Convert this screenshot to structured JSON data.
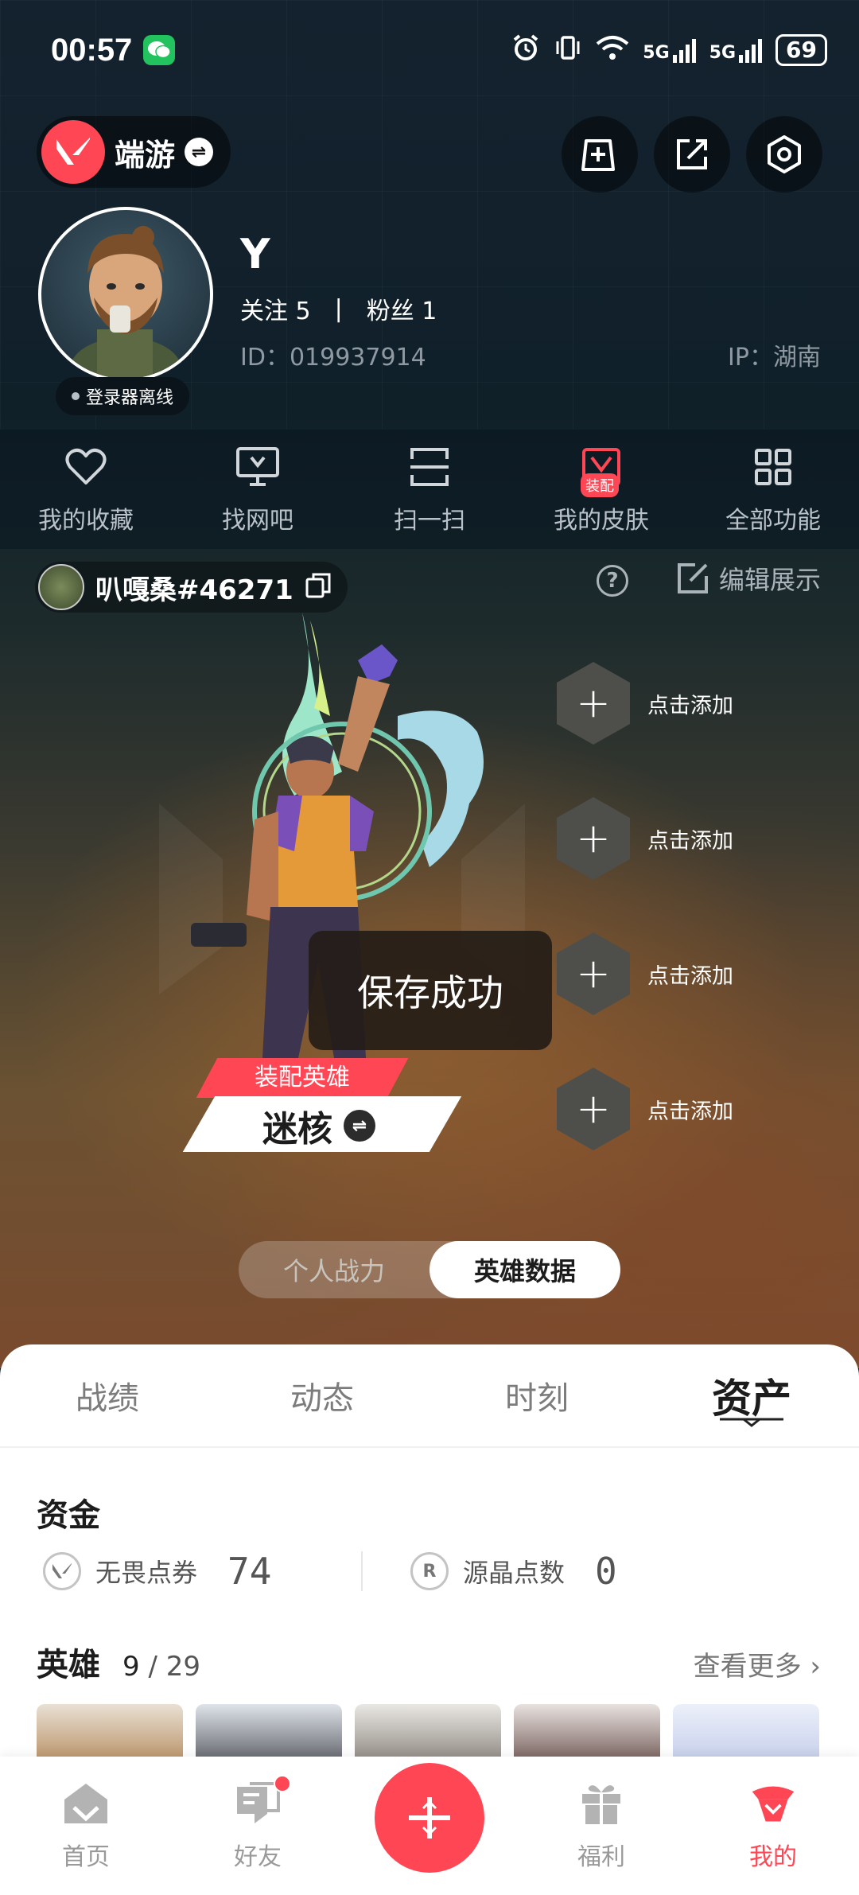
{
  "status_bar": {
    "time": "00:57",
    "signal_1": "5G",
    "signal_2": "5G",
    "battery": "69"
  },
  "header": {
    "brand_name": "端游"
  },
  "profile": {
    "name": "Y",
    "follow_label": "关注 5",
    "separator": "|",
    "fans_label": "粉丝 1",
    "id": "ID：019937914",
    "ip": "IP：湖南",
    "offline_badge": "登录器离线"
  },
  "quick_actions": [
    {
      "label": "我的收藏",
      "icon": "heart-icon"
    },
    {
      "label": "找网吧",
      "icon": "monitor-icon"
    },
    {
      "label": "扫一扫",
      "icon": "scan-icon"
    },
    {
      "label": "我的皮肤",
      "icon": "skin-icon",
      "tag": "装配"
    },
    {
      "label": "全部功能",
      "icon": "grid-icon"
    }
  ],
  "game_account": {
    "riot_id": "叭嘎桑#46271",
    "help": "?",
    "edit_display": "编辑展示"
  },
  "showcase": {
    "slot_label": "点击添加",
    "toast": "保存成功",
    "equip_label": "装配英雄",
    "hero_name": "迷核"
  },
  "toggle": {
    "option_1": "个人战力",
    "option_2": "英雄数据"
  },
  "tabs": [
    "战绩",
    "动态",
    "时刻",
    "资产"
  ],
  "assets": {
    "funds_title": "资金",
    "vp_label": "无畏点券",
    "vp_value": "74",
    "rp_label": "源晶点数",
    "rp_value": "0",
    "heroes_title": "英雄",
    "heroes_owned": "9",
    "heroes_total": "/ 29",
    "see_more": "查看更多"
  },
  "bottom_nav": [
    {
      "label": "首页",
      "icon": "home-icon"
    },
    {
      "label": "好友",
      "icon": "friends-icon"
    },
    {
      "label": "",
      "icon": "plus-icon"
    },
    {
      "label": "福利",
      "icon": "gift-icon"
    },
    {
      "label": "我的",
      "icon": "profile-icon"
    }
  ],
  "colors": {
    "accent": "#ff4655",
    "panel_bg": "#ffffff",
    "page_bg": "#0e1c27"
  }
}
